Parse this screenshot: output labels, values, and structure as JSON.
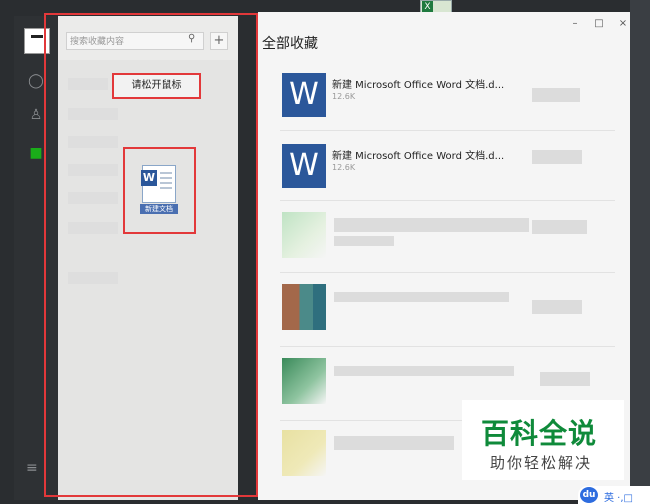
{
  "desktop": {
    "excel_icon": "excel-icon"
  },
  "sidebar": {
    "search_placeholder": "搜索收藏内容",
    "add_symbol": "+",
    "drag_hint": "请松开鼠标",
    "dragged_file_label": "新建文档"
  },
  "window": {
    "title": "全部收藏",
    "minimize": "–",
    "maximize": "□",
    "close": "×"
  },
  "items": [
    {
      "name": "新建 Microsoft Office Word 文档.d...",
      "size": "12.6K"
    },
    {
      "name": "新建 Microsoft Office Word 文档.d...",
      "size": "12.6K"
    }
  ],
  "watermark": {
    "main": "百科全说",
    "sub": "助你轻松解决"
  },
  "ime": {
    "logo": "du",
    "text": "英 ·,□"
  },
  "colors": {
    "word_blue": "#2b579a",
    "highlight_red": "#e2383a",
    "watermark_green": "#0f8a3a"
  }
}
